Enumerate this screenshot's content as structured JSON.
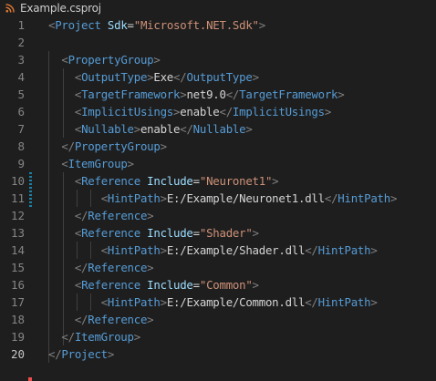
{
  "tab": {
    "icon": "rss-file-icon",
    "title": "Example.csproj",
    "icon_color": "#e37933"
  },
  "lines": [
    {
      "num": "1",
      "parts": [
        {
          "t": "punc",
          "v": "<"
        },
        {
          "t": "tag",
          "v": "Project"
        },
        {
          "t": "txt",
          "v": " "
        },
        {
          "t": "attr",
          "v": "Sdk"
        },
        {
          "t": "txt",
          "v": "="
        },
        {
          "t": "str",
          "v": "\"Microsoft.NET.Sdk\""
        },
        {
          "t": "punc",
          "v": ">"
        }
      ]
    },
    {
      "num": "2",
      "parts": []
    },
    {
      "num": "3",
      "parts": [
        {
          "t": "txt",
          "v": "  "
        },
        {
          "t": "punc",
          "v": "<"
        },
        {
          "t": "tag",
          "v": "PropertyGroup"
        },
        {
          "t": "punc",
          "v": ">"
        }
      ]
    },
    {
      "num": "4",
      "parts": [
        {
          "t": "txt",
          "v": "    "
        },
        {
          "t": "punc",
          "v": "<"
        },
        {
          "t": "tag",
          "v": "OutputType"
        },
        {
          "t": "punc",
          "v": ">"
        },
        {
          "t": "txt",
          "v": "Exe"
        },
        {
          "t": "punc",
          "v": "</"
        },
        {
          "t": "tag",
          "v": "OutputType"
        },
        {
          "t": "punc",
          "v": ">"
        }
      ]
    },
    {
      "num": "5",
      "parts": [
        {
          "t": "txt",
          "v": "    "
        },
        {
          "t": "punc",
          "v": "<"
        },
        {
          "t": "tag",
          "v": "TargetFramework"
        },
        {
          "t": "punc",
          "v": ">"
        },
        {
          "t": "txt",
          "v": "net9.0"
        },
        {
          "t": "punc",
          "v": "</"
        },
        {
          "t": "tag",
          "v": "TargetFramework"
        },
        {
          "t": "punc",
          "v": ">"
        }
      ]
    },
    {
      "num": "6",
      "parts": [
        {
          "t": "txt",
          "v": "    "
        },
        {
          "t": "punc",
          "v": "<"
        },
        {
          "t": "tag",
          "v": "ImplicitUsings"
        },
        {
          "t": "punc",
          "v": ">"
        },
        {
          "t": "txt",
          "v": "enable"
        },
        {
          "t": "punc",
          "v": "</"
        },
        {
          "t": "tag",
          "v": "ImplicitUsings"
        },
        {
          "t": "punc",
          "v": ">"
        }
      ]
    },
    {
      "num": "7",
      "parts": [
        {
          "t": "txt",
          "v": "    "
        },
        {
          "t": "punc",
          "v": "<"
        },
        {
          "t": "tag",
          "v": "Nullable"
        },
        {
          "t": "punc",
          "v": ">"
        },
        {
          "t": "txt",
          "v": "enable"
        },
        {
          "t": "punc",
          "v": "</"
        },
        {
          "t": "tag",
          "v": "Nullable"
        },
        {
          "t": "punc",
          "v": ">"
        }
      ]
    },
    {
      "num": "8",
      "parts": [
        {
          "t": "txt",
          "v": "  "
        },
        {
          "t": "punc",
          "v": "</"
        },
        {
          "t": "tag",
          "v": "PropertyGroup"
        },
        {
          "t": "punc",
          "v": ">"
        }
      ]
    },
    {
      "num": "9",
      "parts": [
        {
          "t": "txt",
          "v": "  "
        },
        {
          "t": "punc",
          "v": "<"
        },
        {
          "t": "tag",
          "v": "ItemGroup"
        },
        {
          "t": "punc",
          "v": ">"
        }
      ]
    },
    {
      "num": "10",
      "parts": [
        {
          "t": "txt",
          "v": "    "
        },
        {
          "t": "punc",
          "v": "<"
        },
        {
          "t": "tag",
          "v": "Reference"
        },
        {
          "t": "txt",
          "v": " "
        },
        {
          "t": "attr",
          "v": "Include"
        },
        {
          "t": "txt",
          "v": "="
        },
        {
          "t": "str",
          "v": "\"Neuronet1\""
        },
        {
          "t": "punc",
          "v": ">"
        }
      ]
    },
    {
      "num": "11",
      "parts": [
        {
          "t": "txt",
          "v": "        "
        },
        {
          "t": "punc",
          "v": "<"
        },
        {
          "t": "tag",
          "v": "HintPath"
        },
        {
          "t": "punc",
          "v": ">"
        },
        {
          "t": "txt",
          "v": "E:/Example/Neuronet1.dll"
        },
        {
          "t": "punc",
          "v": "</"
        },
        {
          "t": "tag",
          "v": "HintPath"
        },
        {
          "t": "punc",
          "v": ">"
        }
      ]
    },
    {
      "num": "12",
      "parts": [
        {
          "t": "txt",
          "v": "    "
        },
        {
          "t": "punc",
          "v": "</"
        },
        {
          "t": "tag",
          "v": "Reference"
        },
        {
          "t": "punc",
          "v": ">"
        }
      ]
    },
    {
      "num": "13",
      "parts": [
        {
          "t": "txt",
          "v": "    "
        },
        {
          "t": "punc",
          "v": "<"
        },
        {
          "t": "tag",
          "v": "Reference"
        },
        {
          "t": "txt",
          "v": " "
        },
        {
          "t": "attr",
          "v": "Include"
        },
        {
          "t": "txt",
          "v": "="
        },
        {
          "t": "str",
          "v": "\"Shader\""
        },
        {
          "t": "punc",
          "v": ">"
        }
      ]
    },
    {
      "num": "14",
      "parts": [
        {
          "t": "txt",
          "v": "        "
        },
        {
          "t": "punc",
          "v": "<"
        },
        {
          "t": "tag",
          "v": "HintPath"
        },
        {
          "t": "punc",
          "v": ">"
        },
        {
          "t": "txt",
          "v": "E:/Example/Shader.dll"
        },
        {
          "t": "punc",
          "v": "</"
        },
        {
          "t": "tag",
          "v": "HintPath"
        },
        {
          "t": "punc",
          "v": ">"
        }
      ]
    },
    {
      "num": "15",
      "parts": [
        {
          "t": "txt",
          "v": "    "
        },
        {
          "t": "punc",
          "v": "</"
        },
        {
          "t": "tag",
          "v": "Reference"
        },
        {
          "t": "punc",
          "v": ">"
        }
      ]
    },
    {
      "num": "16",
      "parts": [
        {
          "t": "txt",
          "v": "    "
        },
        {
          "t": "punc",
          "v": "<"
        },
        {
          "t": "tag",
          "v": "Reference"
        },
        {
          "t": "txt",
          "v": " "
        },
        {
          "t": "attr",
          "v": "Include"
        },
        {
          "t": "txt",
          "v": "="
        },
        {
          "t": "str",
          "v": "\"Common\""
        },
        {
          "t": "punc",
          "v": ">"
        }
      ]
    },
    {
      "num": "17",
      "parts": [
        {
          "t": "txt",
          "v": "        "
        },
        {
          "t": "punc",
          "v": "<"
        },
        {
          "t": "tag",
          "v": "HintPath"
        },
        {
          "t": "punc",
          "v": ">"
        },
        {
          "t": "txt",
          "v": "E:/Example/Common.dll"
        },
        {
          "t": "punc",
          "v": "</"
        },
        {
          "t": "tag",
          "v": "HintPath"
        },
        {
          "t": "punc",
          "v": ">"
        }
      ]
    },
    {
      "num": "18",
      "parts": [
        {
          "t": "txt",
          "v": "    "
        },
        {
          "t": "punc",
          "v": "</"
        },
        {
          "t": "tag",
          "v": "Reference"
        },
        {
          "t": "punc",
          "v": ">"
        }
      ]
    },
    {
      "num": "19",
      "parts": [
        {
          "t": "txt",
          "v": "  "
        },
        {
          "t": "punc",
          "v": "</"
        },
        {
          "t": "tag",
          "v": "ItemGroup"
        },
        {
          "t": "punc",
          "v": ">"
        }
      ]
    },
    {
      "num": "20",
      "active": true,
      "parts": [
        {
          "t": "punc",
          "v": "</"
        },
        {
          "t": "tag",
          "v": "Project"
        },
        {
          "t": "punc",
          "v": ">"
        }
      ]
    }
  ]
}
